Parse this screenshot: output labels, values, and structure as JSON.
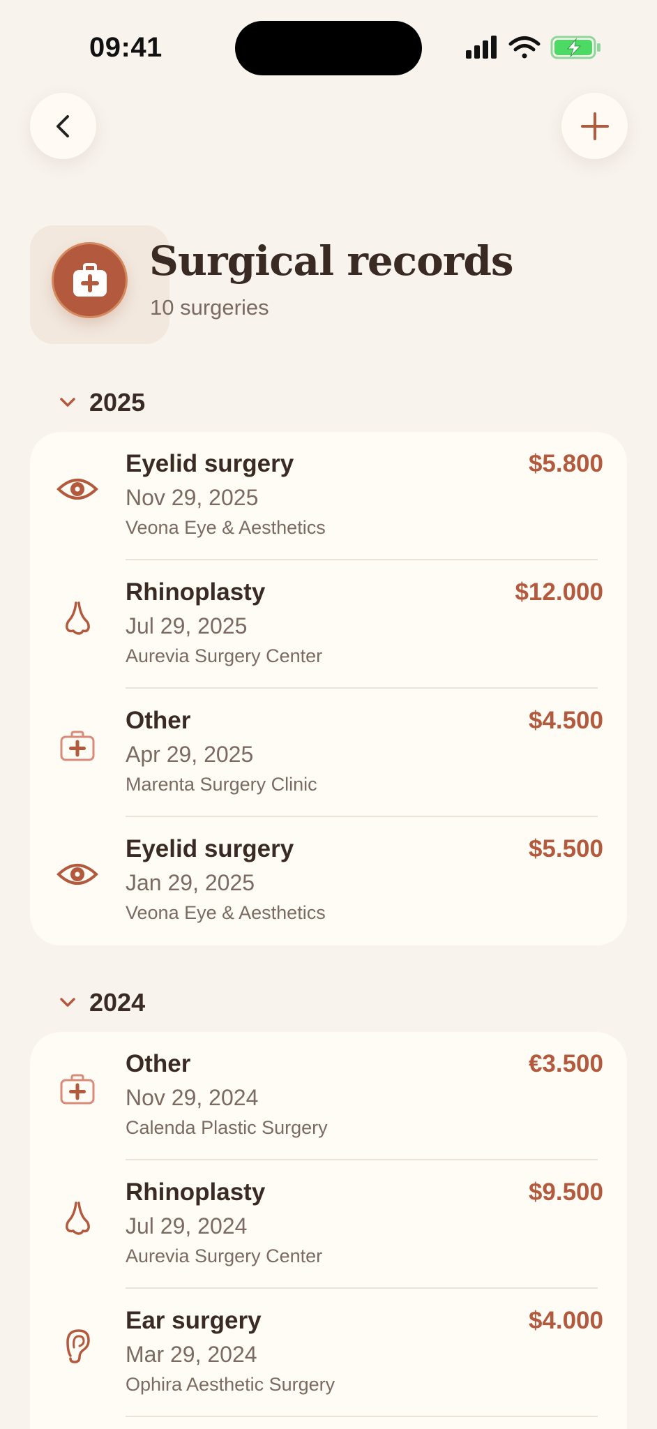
{
  "status_bar": {
    "time": "09:41"
  },
  "header": {
    "title": "Surgical records",
    "subtitle": "10 surgeries"
  },
  "colors": {
    "accent": "#b35a3e",
    "background": "#f8f3ed",
    "card": "#fffcf5",
    "battery": "#4cd964"
  },
  "sections": [
    {
      "year": "2025",
      "items": [
        {
          "icon": "eye-icon",
          "name": "Eyelid surgery",
          "date": "Nov 29, 2025",
          "clinic": "Veona Eye & Aesthetics",
          "price": "$5.800"
        },
        {
          "icon": "nose-icon",
          "name": "Rhinoplasty",
          "date": "Jul 29, 2025",
          "clinic": "Aurevia Surgery Center",
          "price": "$12.000"
        },
        {
          "icon": "medical-kit-icon",
          "name": "Other",
          "date": "Apr 29, 2025",
          "clinic": "Marenta Surgery Clinic",
          "price": "$4.500"
        },
        {
          "icon": "eye-icon",
          "name": "Eyelid surgery",
          "date": "Jan 29, 2025",
          "clinic": "Veona Eye & Aesthetics",
          "price": "$5.500"
        }
      ]
    },
    {
      "year": "2024",
      "items": [
        {
          "icon": "medical-kit-icon",
          "name": "Other",
          "date": "Nov 29, 2024",
          "clinic": "Calenda Plastic Surgery",
          "price": "€3.500"
        },
        {
          "icon": "nose-icon",
          "name": "Rhinoplasty",
          "date": "Jul 29, 2024",
          "clinic": "Aurevia Surgery Center",
          "price": "$9.500"
        },
        {
          "icon": "ear-icon",
          "name": "Ear surgery",
          "date": "Mar 29, 2024",
          "clinic": "Ophira Aesthetic Surgery",
          "price": "$4.000"
        }
      ]
    }
  ]
}
